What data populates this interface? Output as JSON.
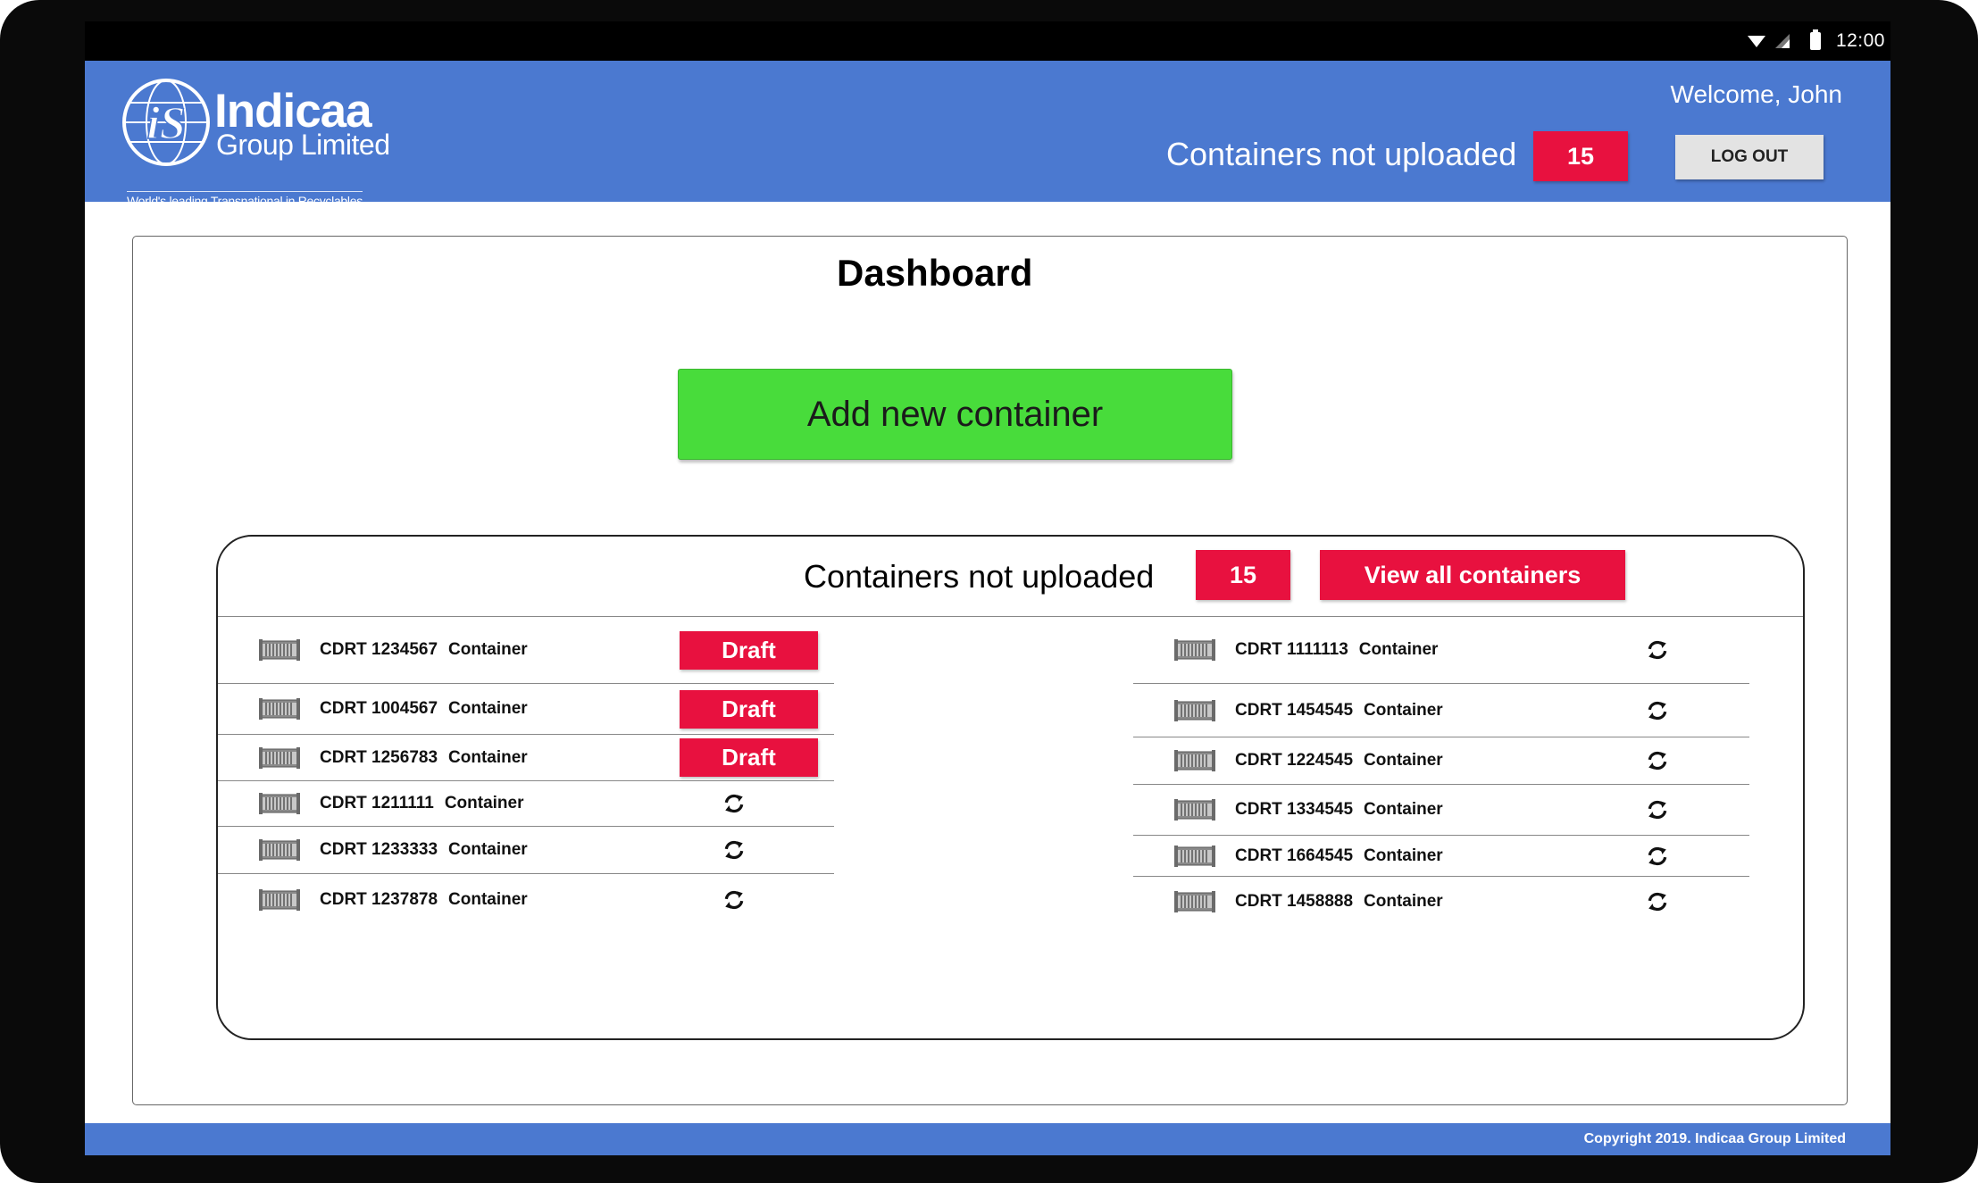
{
  "status_bar": {
    "time": "12:00"
  },
  "header": {
    "logo_name": "Indicaa",
    "logo_sub": "Group Limited",
    "logo_tagline": "World's leading Transnational in Recyclables",
    "welcome": "Welcome, John",
    "pending_label": "Containers not uploaded",
    "pending_count": "15",
    "logout_label": "LOG OUT"
  },
  "dashboard": {
    "title": "Dashboard",
    "add_button": "Add new container"
  },
  "panel": {
    "label": "Containers not uploaded",
    "count": "15",
    "view_all": "View all containers"
  },
  "containers_left": [
    {
      "id": "CDRT 1234567",
      "type": "Container",
      "status": "Draft"
    },
    {
      "id": "CDRT 1004567",
      "type": "Container",
      "status": "Draft"
    },
    {
      "id": "CDRT 1256783",
      "type": "Container",
      "status": "Draft"
    },
    {
      "id": "CDRT 1211111",
      "type": "Container",
      "status": "sync"
    },
    {
      "id": "CDRT 1233333",
      "type": "Container",
      "status": "sync"
    },
    {
      "id": "CDRT 1237878",
      "type": "Container",
      "status": "sync"
    }
  ],
  "containers_right": [
    {
      "id": "CDRT 1111113",
      "type": "Container",
      "status": "sync"
    },
    {
      "id": "CDRT 1454545",
      "type": "Container",
      "status": "sync"
    },
    {
      "id": "CDRT 1224545",
      "type": "Container",
      "status": "sync"
    },
    {
      "id": "CDRT 1334545",
      "type": "Container",
      "status": "sync"
    },
    {
      "id": "CDRT 1664545",
      "type": "Container",
      "status": "sync"
    },
    {
      "id": "CDRT 1458888",
      "type": "Container",
      "status": "sync"
    }
  ],
  "footer": {
    "copyright": "Copyright 2019. Indicaa Group Limited"
  },
  "colors": {
    "header_blue": "#4b79d0",
    "accent_red": "#e8113f",
    "add_green": "#48dc3b"
  }
}
